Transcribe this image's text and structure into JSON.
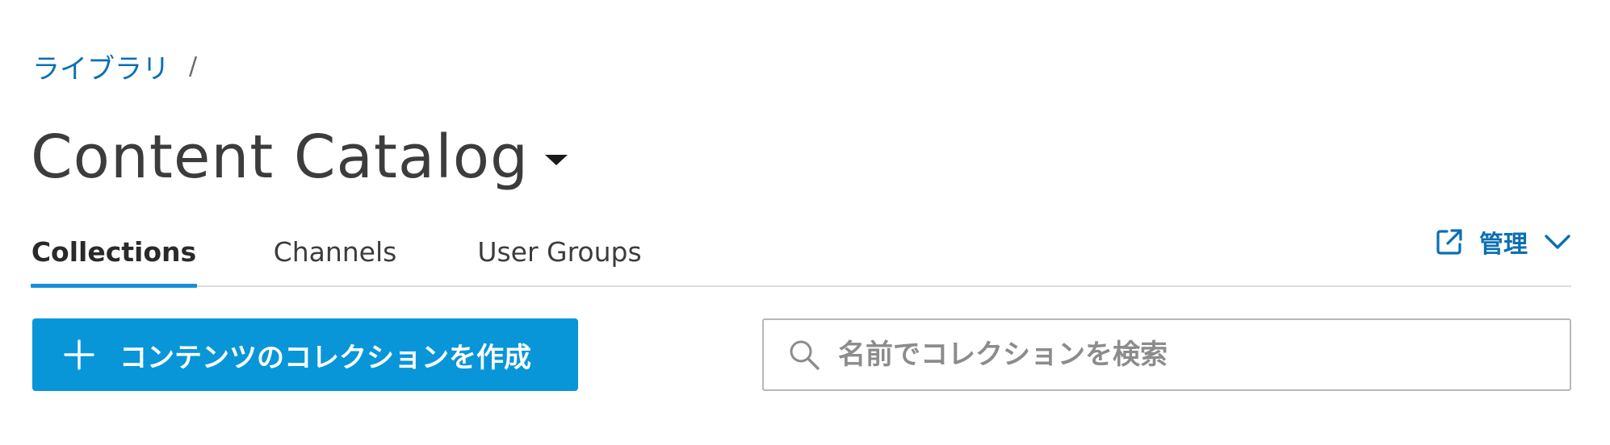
{
  "breadcrumb": {
    "items": [
      {
        "label": "ライブラリ"
      }
    ],
    "separator": "/"
  },
  "header": {
    "title": "Content Catalog"
  },
  "tabs": [
    {
      "label": "Collections",
      "active": true
    },
    {
      "label": "Channels",
      "active": false
    },
    {
      "label": "User Groups",
      "active": false
    }
  ],
  "manage": {
    "label": "管理",
    "icon": "external-link-icon",
    "chevron": "chevron-down-icon"
  },
  "actions": {
    "create_label": "コンテンツのコレクションを作成",
    "create_icon": "plus-icon"
  },
  "search": {
    "placeholder": "名前でコレクションを検索",
    "value": "",
    "icon": "search-icon"
  },
  "colors": {
    "accent": "#0896d8",
    "link": "#0a6fb4",
    "tab_underline": "#1b8fd6"
  }
}
